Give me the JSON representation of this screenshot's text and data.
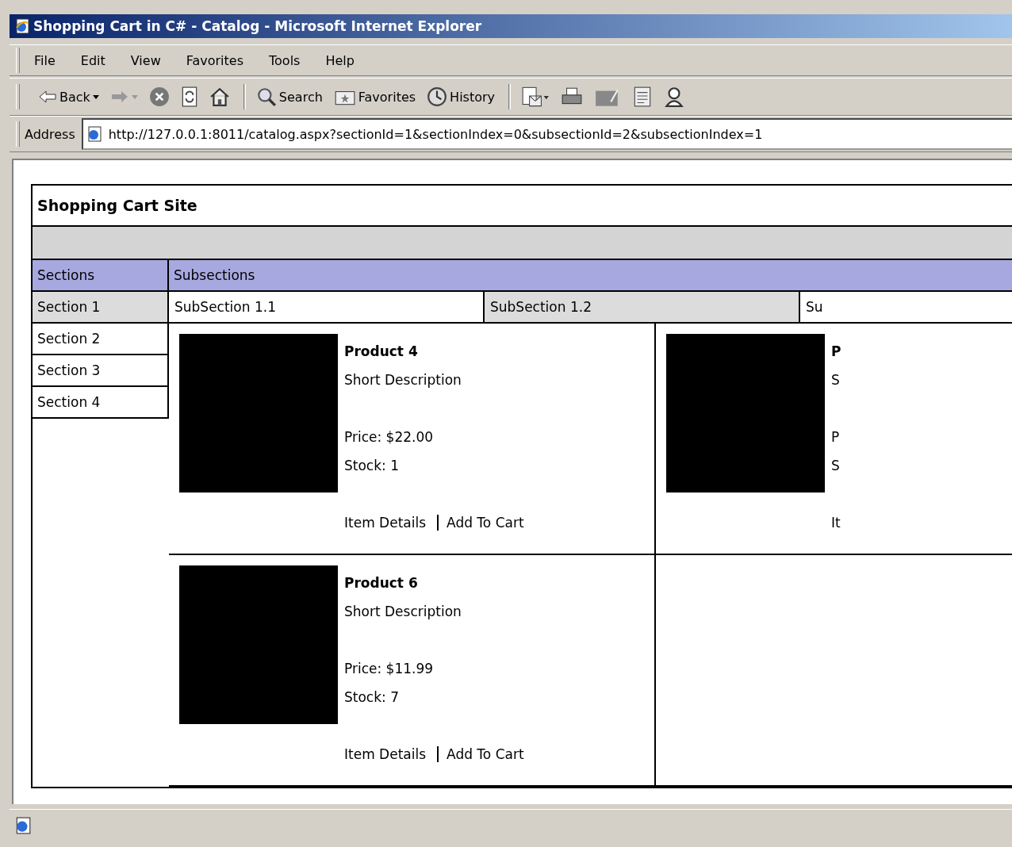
{
  "window": {
    "title": "Shopping Cart in C# - Catalog - Microsoft Internet Explorer"
  },
  "menu": [
    "File",
    "Edit",
    "View",
    "Favorites",
    "Tools",
    "Help"
  ],
  "toolbar": [
    {
      "kind": "back",
      "label": "Back"
    },
    {
      "kind": "forward"
    },
    {
      "kind": "stop"
    },
    {
      "kind": "refresh"
    },
    {
      "kind": "home"
    },
    {
      "kind": "separator"
    },
    {
      "kind": "search",
      "label": "Search"
    },
    {
      "kind": "favorites",
      "label": "Favorites"
    },
    {
      "kind": "history",
      "label": "History"
    },
    {
      "kind": "separator"
    },
    {
      "kind": "mail"
    },
    {
      "kind": "print"
    },
    {
      "kind": "edit"
    },
    {
      "kind": "discuss"
    },
    {
      "kind": "messenger"
    }
  ],
  "address": {
    "label": "Address",
    "value": "http://127.0.0.1:8011/catalog.aspx?sectionId=1&sectionIndex=0&subsectionId=2&subsectionIndex=1"
  },
  "site": {
    "title": "Shopping Cart Site"
  },
  "sections": {
    "heading": "Sections",
    "items": [
      {
        "label": "Section 1",
        "selected": true
      },
      {
        "label": "Section 2",
        "selected": false
      },
      {
        "label": "Section 3",
        "selected": false
      },
      {
        "label": "Section 4",
        "selected": false
      }
    ]
  },
  "subsections": {
    "heading": "Subsections",
    "items": [
      {
        "label": "SubSection 1.1",
        "selected": false
      },
      {
        "label": "SubSection 1.2",
        "selected": true
      },
      {
        "label": "Su",
        "selected": false
      }
    ]
  },
  "products": [
    {
      "name": "Product 4",
      "description": "Short Description",
      "price": "Price: $22.00",
      "stock": "Stock: 1",
      "links": [
        "Item Details",
        "Add To Cart"
      ]
    },
    {
      "name": "P",
      "description": "S",
      "price": "P",
      "stock": "S",
      "links": [
        "It"
      ]
    },
    {
      "name": "Product 6",
      "description": "Short Description",
      "price": "Price: $11.99",
      "stock": "Stock: 7",
      "links": [
        "Item Details",
        "Add To Cart"
      ]
    }
  ]
}
